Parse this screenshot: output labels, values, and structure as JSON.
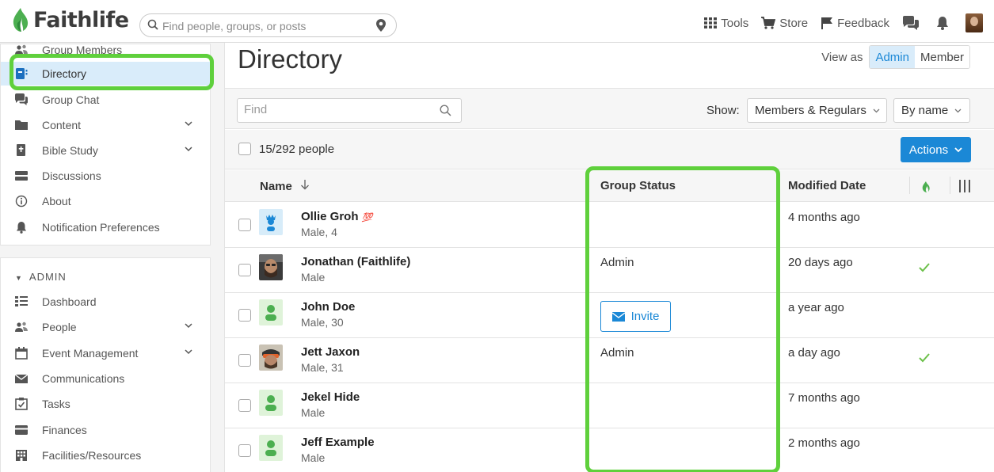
{
  "header": {
    "logo_text": "Faithlife",
    "search_placeholder": "Find people, groups, or posts",
    "nav": [
      "Tools",
      "Store",
      "Feedback"
    ]
  },
  "sidebar": {
    "items": [
      {
        "label": "Group Members",
        "icon": "people-icon"
      },
      {
        "label": "Directory",
        "icon": "directory-icon",
        "active": true
      },
      {
        "label": "Group Chat",
        "icon": "chat-icon"
      },
      {
        "label": "Content",
        "icon": "folder-icon",
        "expandable": true
      },
      {
        "label": "Bible Study",
        "icon": "bible-icon",
        "expandable": true
      },
      {
        "label": "Discussions",
        "icon": "discussions-icon"
      },
      {
        "label": "About",
        "icon": "info-icon"
      },
      {
        "label": "Notification Preferences",
        "icon": "bell-icon"
      }
    ],
    "admin_header": "ADMIN",
    "admin_items": [
      {
        "label": "Dashboard",
        "icon": "dashboard-icon"
      },
      {
        "label": "People",
        "icon": "people-icon",
        "expandable": true
      },
      {
        "label": "Event Management",
        "icon": "calendar-icon",
        "expandable": true
      },
      {
        "label": "Communications",
        "icon": "envelope-icon"
      },
      {
        "label": "Tasks",
        "icon": "tasks-icon"
      },
      {
        "label": "Finances",
        "icon": "card-icon"
      },
      {
        "label": "Facilities/Resources",
        "icon": "building-icon"
      }
    ]
  },
  "main": {
    "title": "Directory",
    "view_as_label": "View as",
    "view_as_options": [
      "Admin",
      "Member"
    ],
    "view_as_selected": "Admin",
    "find_placeholder": "Find",
    "show_label": "Show:",
    "show_value": "Members & Regulars",
    "sort_value": "By name",
    "count_text": "15/292 people",
    "actions_label": "Actions",
    "columns": {
      "name": "Name",
      "status": "Group Status",
      "modified": "Modified Date"
    },
    "rows": [
      {
        "name": "Ollie Groh",
        "sub": "Male, 4",
        "status": "",
        "modified": "4 months ago",
        "check": false,
        "avatar": "child-avatar",
        "badge": "💯"
      },
      {
        "name": "Jonathan (Faithlife)",
        "sub": "Male",
        "status": "Admin",
        "modified": "20 days ago",
        "check": true,
        "avatar": "photo-avatar"
      },
      {
        "name": "John Doe",
        "sub": "Male, 30",
        "status": "",
        "invite_label": "Invite",
        "modified": "a year ago",
        "check": false,
        "avatar": "generic-avatar"
      },
      {
        "name": "Jett Jaxon",
        "sub": "Male, 31",
        "status": "Admin",
        "modified": "a day ago",
        "check": true,
        "avatar": "photo-avatar"
      },
      {
        "name": "Jekel Hide",
        "sub": "Male",
        "status": "",
        "modified": "7 months ago",
        "check": false,
        "avatar": "generic-avatar"
      },
      {
        "name": "Jeff Example",
        "sub": "Male",
        "status": "",
        "modified": "2 months ago",
        "check": false,
        "avatar": "generic-avatar"
      }
    ]
  },
  "colors": {
    "accent": "#1b88d6",
    "highlight": "#5fd03c",
    "brand_green": "#4caf50",
    "check_green": "#6cc04a"
  }
}
